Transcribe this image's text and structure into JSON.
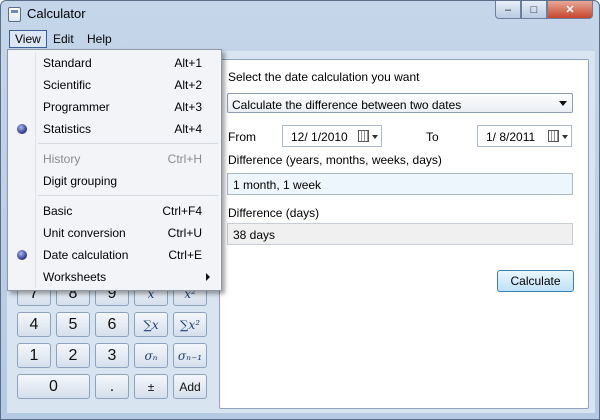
{
  "window": {
    "title": "Calculator",
    "min_glyph": "–",
    "max_glyph": "□",
    "close_glyph": "✕"
  },
  "menubar": {
    "view": "View",
    "edit": "Edit",
    "help": "Help"
  },
  "view_menu": {
    "items": [
      {
        "label": "Standard",
        "shortcut": "Alt+1",
        "checked": false,
        "disabled": false
      },
      {
        "label": "Scientific",
        "shortcut": "Alt+2",
        "checked": false,
        "disabled": false
      },
      {
        "label": "Programmer",
        "shortcut": "Alt+3",
        "checked": false,
        "disabled": false
      },
      {
        "label": "Statistics",
        "shortcut": "Alt+4",
        "checked": true,
        "disabled": false
      },
      {
        "label": "History",
        "shortcut": "Ctrl+H",
        "checked": false,
        "disabled": true
      },
      {
        "label": "Digit grouping",
        "shortcut": "",
        "checked": false,
        "disabled": false
      },
      {
        "label": "Basic",
        "shortcut": "Ctrl+F4",
        "checked": false,
        "disabled": false
      },
      {
        "label": "Unit conversion",
        "shortcut": "Ctrl+U",
        "checked": false,
        "disabled": false
      },
      {
        "label": "Date calculation",
        "shortcut": "Ctrl+E",
        "checked": true,
        "disabled": false
      },
      {
        "label": "Worksheets",
        "shortcut": "",
        "checked": false,
        "disabled": false
      }
    ]
  },
  "date_panel": {
    "prompt": "Select the date calculation you want",
    "mode": "Calculate the difference between two dates",
    "from_label": "From",
    "from_value": "12/ 1/2010",
    "to_label": "To",
    "to_value": "1/ 8/2011",
    "diff_label": "Difference (years, months, weeks, days)",
    "diff_value": "1 month, 1 week",
    "days_label": "Difference (days)",
    "days_value": "38 days",
    "calculate_button": "Calculate"
  },
  "keypad": {
    "row1": [
      "7",
      "8",
      "9",
      "x",
      "x²"
    ],
    "row2": [
      "4",
      "5",
      "6",
      "∑x",
      "∑x²"
    ],
    "row3": [
      "1",
      "2",
      "3",
      "σₙ",
      "σₙ₋₁"
    ],
    "row4": [
      "0",
      ".",
      "±",
      "Add"
    ]
  },
  "colors": {
    "accent": "#3c6098",
    "radio": "#25338c",
    "close": "#c8452c"
  }
}
